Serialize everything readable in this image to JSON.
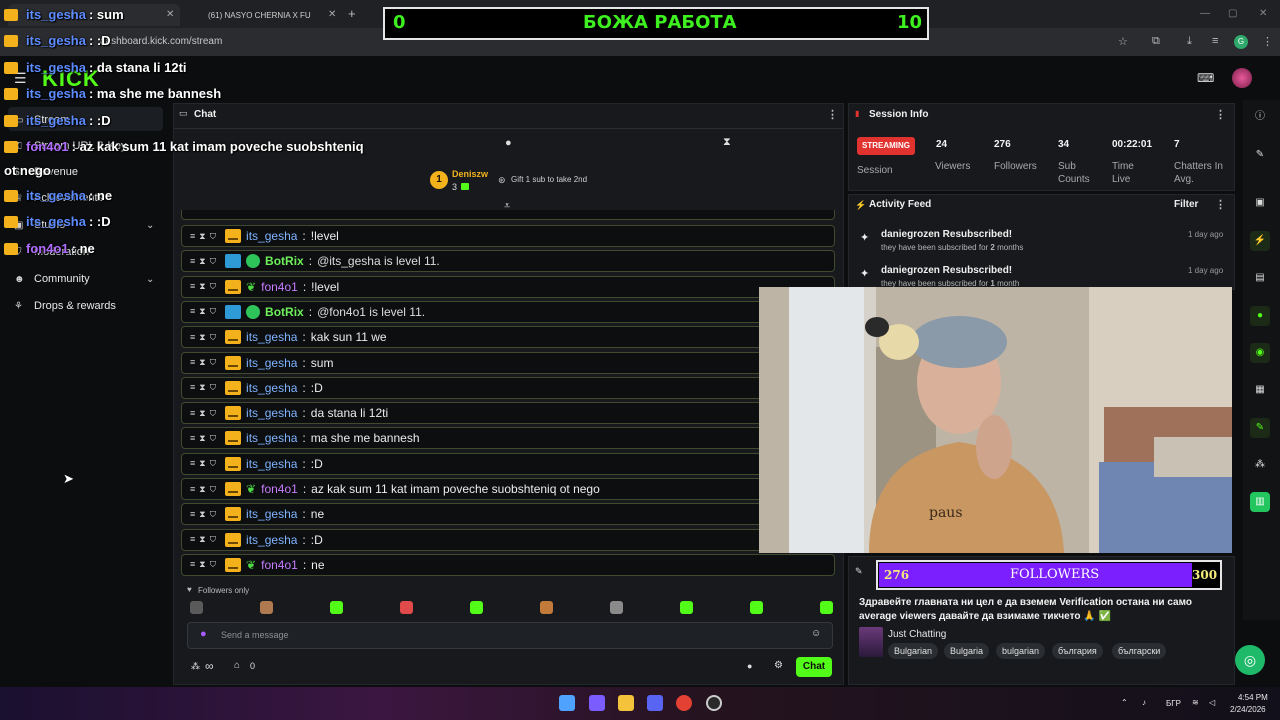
{
  "browser": {
    "tab1_title": "d",
    "tab2_title": "(61) NASYO CHERNIA X FU",
    "url": "dashboard.kick.com/stream",
    "new_tab": "+"
  },
  "kick": {
    "logo": "KICK"
  },
  "nav": {
    "items": [
      {
        "label": "Stream",
        "icon": "stream-icon"
      },
      {
        "label": "Stream URL & Key",
        "icon": "key-icon"
      },
      {
        "label": "Revenue",
        "icon": "revenue-icon"
      },
      {
        "label": "Achievements",
        "icon": "trophy-icon"
      },
      {
        "label": "Studio",
        "icon": "studio-icon"
      },
      {
        "label": "Moderation",
        "icon": "shield-icon"
      },
      {
        "label": "Community",
        "icon": "community-icon"
      },
      {
        "label": "Drops & rewards",
        "icon": "gift-icon"
      }
    ]
  },
  "chat": {
    "panel_title": "Chat",
    "pinned_banner": "az kak sum 11 kat imam poveche suobshteniq ot nego",
    "gifter": {
      "rank": "1",
      "name": "Deniszw",
      "count": "3",
      "cta": "Gift 1 sub to take 2nd"
    },
    "messages": [
      {
        "user": "its_gesha",
        "color": "blue",
        "text": "!level",
        "badges": [
          "crown"
        ]
      },
      {
        "user": "BotRix",
        "color": "green",
        "text": "@its_gesha is level 11.",
        "badges": [
          "hammer",
          "verified"
        ]
      },
      {
        "user": "fon4o1",
        "color": "purple",
        "text": "!level",
        "badges": [
          "crown",
          "leaf"
        ]
      },
      {
        "user": "BotRix",
        "color": "green",
        "text": "@fon4o1 is level 11.",
        "badges": [
          "hammer",
          "verified"
        ]
      },
      {
        "user": "its_gesha",
        "color": "blue",
        "text": "kak sun 11 we",
        "badges": [
          "crown"
        ]
      },
      {
        "user": "its_gesha",
        "color": "blue",
        "text": "sum",
        "badges": [
          "crown"
        ]
      },
      {
        "user": "its_gesha",
        "color": "blue",
        "text": ":D",
        "badges": [
          "crown"
        ]
      },
      {
        "user": "its_gesha",
        "color": "blue",
        "text": "da stana li 12ti",
        "badges": [
          "crown"
        ]
      },
      {
        "user": "its_gesha",
        "color": "blue",
        "text": "ma she me bannesh",
        "badges": [
          "crown"
        ]
      },
      {
        "user": "its_gesha",
        "color": "blue",
        "text": ":D",
        "badges": [
          "crown"
        ]
      },
      {
        "user": "fon4o1",
        "color": "purple",
        "text": "az kak sum 11 kat imam poveche suobshteniq ot nego",
        "badges": [
          "crown",
          "leaf"
        ]
      },
      {
        "user": "its_gesha",
        "color": "blue",
        "text": "ne",
        "badges": [
          "crown"
        ]
      },
      {
        "user": "its_gesha",
        "color": "blue",
        "text": ":D",
        "badges": [
          "crown"
        ]
      },
      {
        "user": "fon4o1",
        "color": "purple",
        "text": "ne",
        "badges": [
          "crown",
          "leaf"
        ]
      }
    ],
    "followers_only": "Followers only",
    "input_placeholder": "Send a message",
    "viewer_count": "0",
    "infinity": "∞",
    "send_label": "Chat"
  },
  "session": {
    "title": "Session Info",
    "status": "STREAMING",
    "session_label": "Session",
    "stats": [
      {
        "value": "24",
        "label": "Viewers"
      },
      {
        "value": "276",
        "label": "Followers"
      },
      {
        "value": "34",
        "label": "Sub Counts"
      },
      {
        "value": "00:22:01",
        "label": "Time Live"
      },
      {
        "value": "7",
        "label": "Chatters In Avg."
      }
    ]
  },
  "activity": {
    "title": "Activity Feed",
    "filter": "Filter",
    "items": [
      {
        "title": "daniegrozen Resubscribed!",
        "sub_pre": "they have been subscribed for ",
        "months": "2",
        "sub_post": " months",
        "time": "1 day ago"
      },
      {
        "title": "daniegrozen Resubscribed!",
        "sub_pre": "they have been subscribed for ",
        "months": "1",
        "sub_post": " month",
        "time": "1 day ago"
      }
    ]
  },
  "stream_info": {
    "title_text": "Здравейте главната ни цел е да вземем Verification остана ни само average viewers давайте да взимаме тикчето 🙏 ✅",
    "category": "Just Chatting",
    "tags": [
      "Bulgarian",
      "Bulgaria",
      "bulgarian",
      "българия",
      "български"
    ]
  },
  "overlay": {
    "score_left": "0",
    "score_title": "БОЖА РАБОТА",
    "score_right": "10",
    "chat_lines": [
      {
        "user": "its_gesha",
        "color": "blue",
        "text": ": sum"
      },
      {
        "user": "its_gesha",
        "color": "blue",
        "text": ": :D"
      },
      {
        "user": "its_gesha",
        "color": "blue",
        "text": ": da stana li 12ti"
      },
      {
        "user": "its_gesha",
        "color": "blue",
        "text": ": ma she me bannesh"
      },
      {
        "user": "its_gesha",
        "color": "blue",
        "text": ": :D"
      },
      {
        "user": "fon4o1",
        "color": "purple",
        "text": ": az kak sum 11 kat imam poveche suobshteniq"
      },
      {
        "user": "",
        "color": "white",
        "text": "ot nego"
      },
      {
        "user": "its_gesha",
        "color": "blue",
        "text": ": ne"
      },
      {
        "user": "its_gesha",
        "color": "blue",
        "text": ": :D"
      },
      {
        "user": "fon4o1",
        "color": "purple",
        "text": ": ne"
      }
    ],
    "follower_goal": {
      "current": "276",
      "label": "FOLLOWERS",
      "target": "300",
      "progress": 0.92
    }
  },
  "taskbar": {
    "lang": "БГР",
    "time": "4:54 PM",
    "date": "2/24/2026"
  },
  "colors": {
    "kick_green": "#53fc18",
    "streaming_red": "#e0322f",
    "follower_purple": "#7c1fff"
  }
}
